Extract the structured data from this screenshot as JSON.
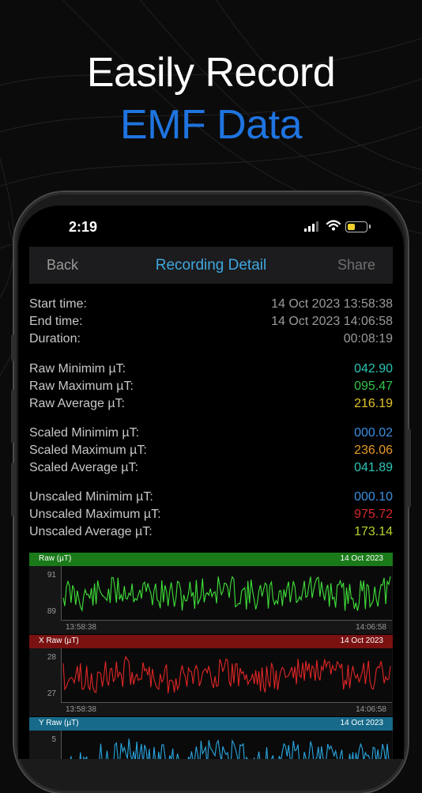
{
  "headline": {
    "line1": "Easily Record",
    "line2": "EMF Data"
  },
  "status_bar": {
    "time": "2:19"
  },
  "nav": {
    "back": "Back",
    "title": "Recording Detail",
    "share": "Share"
  },
  "summary": [
    {
      "label": "Start time:",
      "value": "14 Oct 2023 13:58:38",
      "color": "#9a9a9a"
    },
    {
      "label": "End time:",
      "value": "14 Oct 2023 14:06:58",
      "color": "#9a9a9a"
    },
    {
      "label": "Duration:",
      "value": "00:08:19",
      "color": "#9a9a9a"
    },
    {
      "label": "Raw Minimim µT:",
      "value": "042.90",
      "color": "#2ec4b6"
    },
    {
      "label": "Raw Maximum µT:",
      "value": "095.47",
      "color": "#33c24a"
    },
    {
      "label": "Raw Average µT:",
      "value": "216.19",
      "color": "#e6c229"
    },
    {
      "label": "Scaled Minimim µT:",
      "value": "000.02",
      "color": "#3a8fe0"
    },
    {
      "label": "Scaled Maximum µT:",
      "value": "236.06",
      "color": "#e89a2a"
    },
    {
      "label": "Scaled Average µT:",
      "value": "041.89",
      "color": "#2ec4b6"
    },
    {
      "label": "Unscaled Minimim µT:",
      "value": "000.10",
      "color": "#3a8fe0"
    },
    {
      "label": "Unscaled Maximum µT:",
      "value": "975.72",
      "color": "#d42a2a"
    },
    {
      "label": "Unscaled Average µT:",
      "value": "173.14",
      "color": "#b8d22a"
    }
  ],
  "chart_data": [
    {
      "type": "line",
      "title": "Raw (µT)",
      "date": "14 Oct 2023",
      "header_color": "#1a7a1a",
      "line_color": "#3fe03a",
      "ylim": [
        89,
        91
      ],
      "y_ticks": [
        "91",
        "89"
      ],
      "x_ticks": [
        "13:58:38",
        "14:06:58"
      ],
      "seed": 11
    },
    {
      "type": "line",
      "title": "X Raw (µT)",
      "date": "14 Oct 2023",
      "header_color": "#7a1212",
      "line_color": "#e02626",
      "ylim": [
        27,
        28
      ],
      "y_ticks": [
        "28",
        "27"
      ],
      "x_ticks": [
        "13:58:38",
        "14:06:58"
      ],
      "seed": 23
    },
    {
      "type": "line",
      "title": "Y Raw (µT)",
      "date": "14 Oct 2023",
      "header_color": "#176a8a",
      "line_color": "#2aa6e0",
      "ylim": [
        4,
        5
      ],
      "y_ticks": [
        "5"
      ],
      "x_ticks": [],
      "seed": 37
    }
  ]
}
